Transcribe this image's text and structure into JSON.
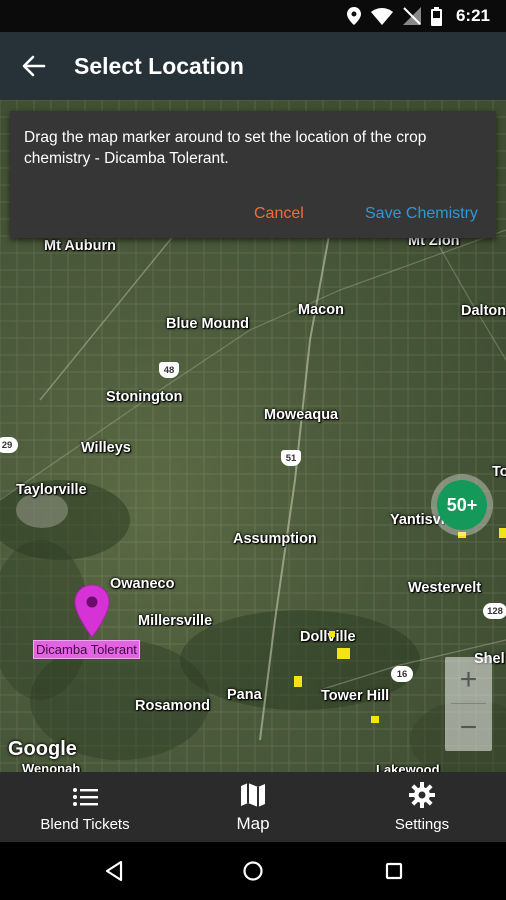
{
  "status_bar": {
    "time": "6:21"
  },
  "app_bar": {
    "title": "Select Location"
  },
  "dialog": {
    "message": "Drag the map marker around to set the location of the crop chemistry - Dicamba Tolerant.",
    "cancel_label": "Cancel",
    "save_label": "Save Chemistry"
  },
  "map": {
    "places": {
      "mt_auburn": "Mt Auburn",
      "mt_zion": "Mt Zion",
      "macon": "Macon",
      "dalton": "Dalton",
      "blue_mound": "Blue Mound",
      "stonington": "Stonington",
      "moweaqua": "Moweaqua",
      "willeys": "Willeys",
      "taylorville": "Taylorville",
      "assumption": "Assumption",
      "yantisville": "Yantisvi",
      "owaneco": "Owaneco",
      "westervelt": "Westervelt",
      "millersville": "Millersville",
      "dollville": "Dollville",
      "shelbyville": "Shel",
      "pana": "Pana",
      "tower_hill": "Tower Hill",
      "rosamond": "Rosamond",
      "lakewood": "Lakewood",
      "wenonah": "Wenonah",
      "to_edge": "To"
    },
    "route_shields": {
      "r48": "48",
      "r51": "51",
      "r29": "29",
      "r16": "16",
      "r128": "128"
    },
    "cluster_label": "50+",
    "marker_label": "Dicamba Tolerant",
    "attribution": "Google",
    "zoom_in": "+",
    "zoom_out": "−"
  },
  "bottom_nav": {
    "items": [
      {
        "label": "Blend Tickets",
        "icon": "list-icon"
      },
      {
        "label": "Map",
        "icon": "map-icon"
      },
      {
        "label": "Settings",
        "icon": "gear-icon"
      }
    ]
  },
  "colors": {
    "app_bar": "#263238",
    "cancel": "#f26a3f",
    "save": "#2a9bd6",
    "cluster": "#15995a",
    "marker": "#d633d6"
  }
}
